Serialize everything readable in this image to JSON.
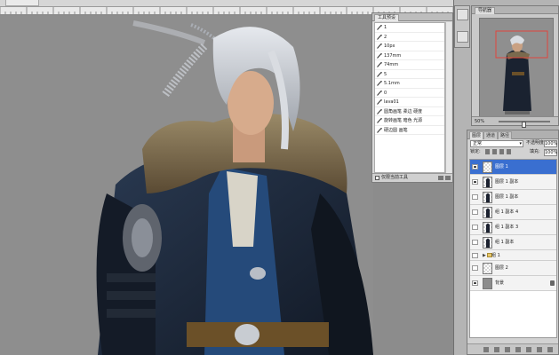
{
  "tool_presets": {
    "tab_label": "工具预设",
    "items": [
      "1",
      "2",
      "10px",
      "137mm",
      "74mm",
      "5",
      "5.1mm",
      "0",
      "lava01",
      "圆角画笔 柔边 硬度",
      "旋转画笔 暗色 光源",
      "硬边圆 画笔"
    ],
    "footer_checkbox_label": "仅限当前工具"
  },
  "navigator": {
    "tab_label": "导航器",
    "zoom": "50%",
    "zoom_fraction": 0.5
  },
  "layers": {
    "tabs": [
      "图层",
      "通道",
      "路径"
    ],
    "active_tab": 0,
    "blend_mode": "正常",
    "opacity_label": "不透明度:",
    "opacity_value": "100%",
    "lock_label": "锁定:",
    "fill_label": "填充:",
    "fill_value": "100%",
    "items": [
      {
        "name": "图层 1",
        "visible": true,
        "selected": true,
        "kind": "layer"
      },
      {
        "name": "图层 1 副本",
        "visible": true,
        "selected": false,
        "kind": "figure"
      },
      {
        "name": "图层 1 副本",
        "visible": false,
        "selected": false,
        "kind": "figure"
      },
      {
        "name": "组 1 副本 4",
        "visible": false,
        "selected": false,
        "kind": "figure"
      },
      {
        "name": "组 1 副本 3",
        "visible": false,
        "selected": false,
        "kind": "figure"
      },
      {
        "name": "组 1 副本",
        "visible": false,
        "selected": false,
        "kind": "figure"
      },
      {
        "name": "组 1",
        "visible": false,
        "selected": false,
        "kind": "group"
      },
      {
        "name": "图层 2",
        "visible": false,
        "selected": false,
        "kind": "layer"
      },
      {
        "name": "背景",
        "visible": true,
        "selected": false,
        "kind": "background"
      }
    ]
  },
  "colors": {
    "canvas": "#8e8e8e",
    "selection": "#3a6fd0",
    "panel": "#d2d2d2",
    "nav_view_box": "#e0463c"
  }
}
